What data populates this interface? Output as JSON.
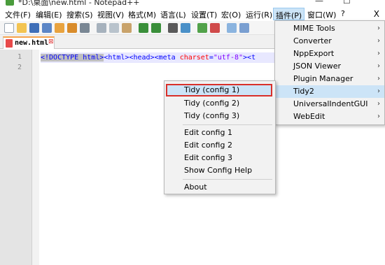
{
  "window": {
    "title": "*D:\\桌面\\new.html - Notepad++",
    "minimize_glyph": "—",
    "maximize_glyph": "☐",
    "close_glyph": "X"
  },
  "menubar": {
    "items": [
      "文件(F)",
      "编辑(E)",
      "搜索(S)",
      "视图(V)",
      "格式(M)",
      "语言(L)",
      "设置(T)",
      "宏(O)",
      "运行(R)",
      "插件(P)",
      "窗口(W)",
      "?"
    ],
    "active_index": 9
  },
  "toolbar": {
    "icons": [
      "new-file-icon",
      "open-file-icon",
      "save-icon",
      "save-all-icon",
      "close-icon",
      "close-all-icon",
      "print-icon",
      "cut-icon",
      "copy-icon",
      "paste-icon",
      "undo-icon",
      "redo-icon",
      "find-icon",
      "replace-icon",
      "zoom-in-icon",
      "zoom-out-icon",
      "sync-scroll-icon",
      "wrap-icon"
    ]
  },
  "tabs": [
    {
      "label": "new.html",
      "close": "⊠",
      "modified": true
    }
  ],
  "editor": {
    "line_numbers": [
      "1",
      "2"
    ],
    "line1": {
      "doctype": "<!DOCTYPE html>",
      "html_tag": "<html>",
      "head_tag": "<head>",
      "meta_open": "<meta ",
      "attr": "charset",
      "eq": "=",
      "val": "\"utf-8\"",
      "meta_close": "><t"
    }
  },
  "plugins_menu": {
    "items": [
      {
        "label": "MIME Tools",
        "submenu": true
      },
      {
        "label": "Converter",
        "submenu": true
      },
      {
        "label": "NppExport",
        "submenu": true
      },
      {
        "label": "JSON Viewer",
        "submenu": true
      },
      {
        "label": "Plugin Manager",
        "submenu": true
      },
      {
        "label": "Tidy2",
        "submenu": true,
        "highlighted": true
      },
      {
        "label": "UniversalIndentGUI",
        "submenu": true
      },
      {
        "label": "WebEdit",
        "submenu": true
      }
    ],
    "arrow_glyph": "›"
  },
  "tidy2_menu": {
    "items": [
      "Tidy (config 1)",
      "Tidy (config 2)",
      "Tidy (config 3)",
      "Edit config 1",
      "Edit config 2",
      "Edit config 3",
      "Show Config Help",
      "About"
    ],
    "highlighted_index": 0
  },
  "colors": {
    "menu_highlight": "#cce4f7",
    "annotation_box": "#d9302a",
    "tab_accent": "#f7a34b"
  }
}
